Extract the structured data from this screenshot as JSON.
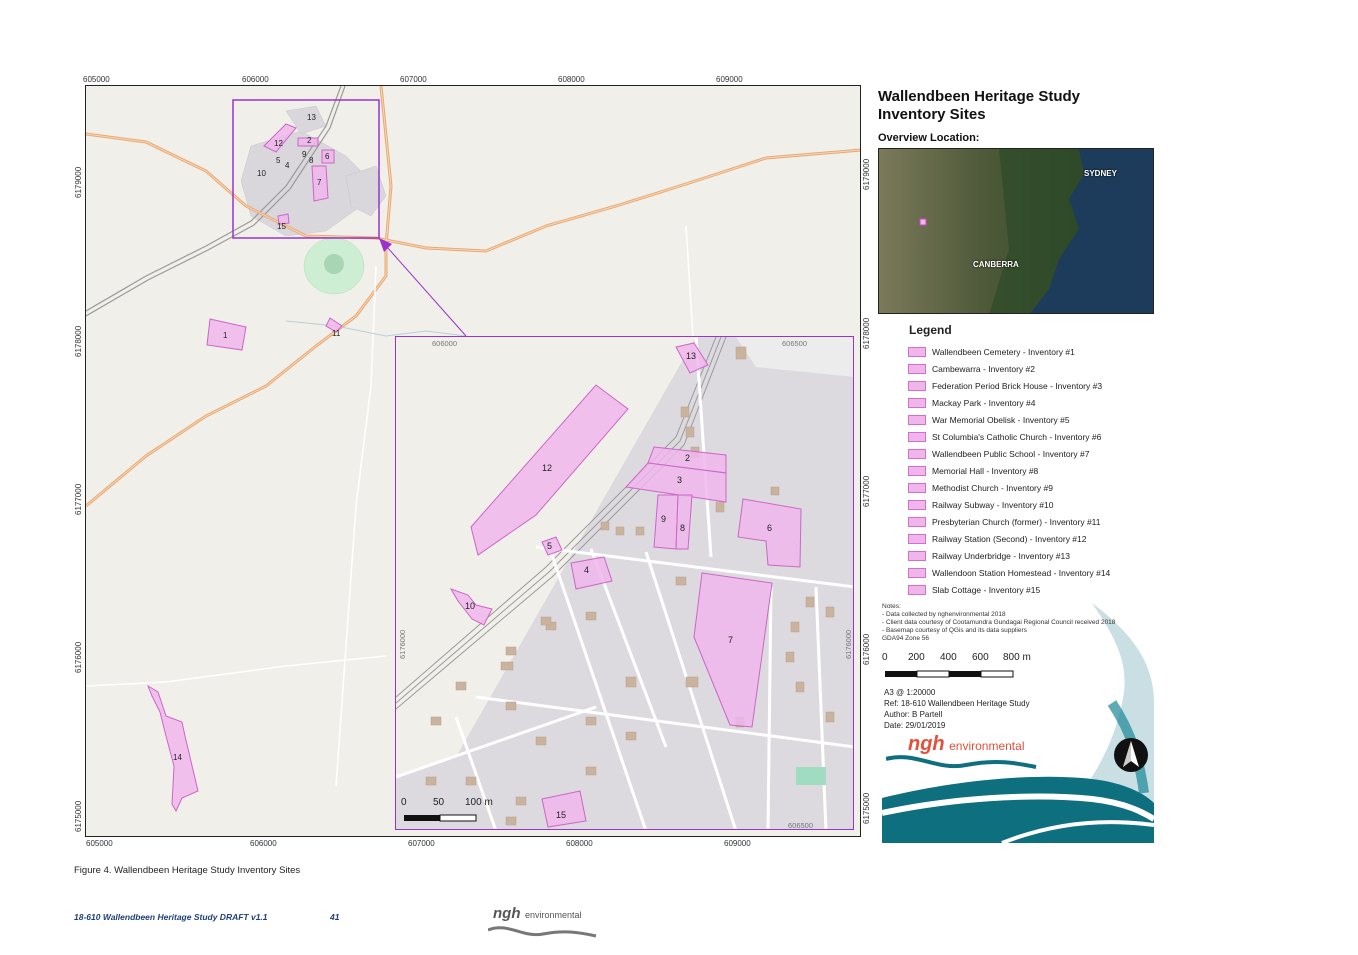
{
  "coords": {
    "x_top": [
      "605000",
      "606000",
      "607000",
      "608000",
      "609000"
    ],
    "x_bottom": [
      "605000",
      "606000",
      "607000",
      "608000",
      "609000"
    ],
    "y_left": [
      "6179000",
      "6178000",
      "6177000",
      "6176000",
      "6175000"
    ],
    "y_right": [
      "6179000",
      "6178000",
      "6177000",
      "6176000",
      "6175000"
    ]
  },
  "main_sites": [
    "1",
    "2",
    "4",
    "5",
    "6",
    "7",
    "8",
    "9",
    "10",
    "11",
    "12",
    "13",
    "14",
    "15"
  ],
  "inset": {
    "coords_top": [
      "606000",
      "606500"
    ],
    "coord_bottom": "606500",
    "coord_left": "6176000",
    "coord_right": "6176000",
    "sites": [
      "13",
      "12",
      "2",
      "3",
      "9",
      "8",
      "6",
      "5",
      "4",
      "10",
      "7",
      "15"
    ],
    "scalebar": [
      "0",
      "50",
      "100 m"
    ]
  },
  "panel": {
    "title_line1": "Wallendbeen Heritage Study",
    "title_line2": "Inventory Sites",
    "overview_title": "Overview Location:",
    "overview_labels": {
      "sydney": "SYDNEY",
      "canberra": "CANBERRA"
    },
    "legend_title": "Legend",
    "legend": [
      "Wallendbeen Cemetery - Inventory #1",
      "Cambewarra - Inventory #2",
      "Federation Period Brick House - Inventory #3",
      "Mackay Park - Inventory #4",
      "War Memorial Obelisk - Inventory #5",
      "St Columbia's Catholic Church - Inventory #6",
      "Wallendbeen Public School - Inventory #7",
      "Memorial Hall - Inventory #8",
      "Methodist Church - Inventory #9",
      "Railway Subway - Inventory #10",
      "Presbyterian Church (former) - Inventory #11",
      "Railway Station (Second) - Inventory #12",
      "Railway Underbridge - Inventory #13",
      "Wallendoon Station Homestead - Inventory #14",
      "Slab Cottage - Inventory #15"
    ],
    "notes": [
      "Notes:",
      "- Data collected by nghenvironmental 2018",
      "- Client data courtesy of Cootamundra Gundagai Regional Council received 2018",
      "- Basemap courtesy of QGis and its data suppliers",
      "  GDA94 Zone 56"
    ],
    "scale": [
      "0",
      "200",
      "400",
      "600",
      "800 m"
    ],
    "meta": [
      "A3 @ 1:20000",
      "Ref: 18-610 Wallendbeen Heritage Study",
      "Author: B Partell",
      "Date: 29/01/2019"
    ],
    "logo_ngh": "ngh",
    "logo_env": "environmental"
  },
  "caption": "Figure 4.  Wallendbeen Heritage Study Inventory Sites",
  "footer": {
    "doc": "18-610 Wallendbeen Heritage Study DRAFT v1.1",
    "page": "41"
  },
  "colors": {
    "site_fill": "#f0b6ec",
    "site_stroke": "#cc66c8",
    "inset_frame": "#9933cc",
    "road": "#e8a070",
    "teal": "#0e6f7e"
  }
}
